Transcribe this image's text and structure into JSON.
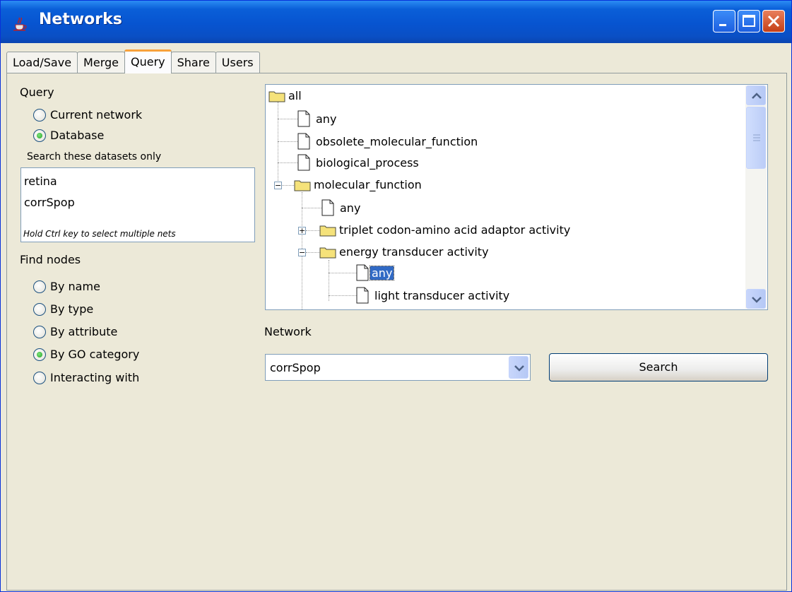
{
  "window": {
    "title": "Networks"
  },
  "tabs": [
    {
      "label": "Load/Save",
      "active": false
    },
    {
      "label": "Merge",
      "active": false
    },
    {
      "label": "Query",
      "active": true
    },
    {
      "label": "Share",
      "active": false
    },
    {
      "label": "Users",
      "active": false
    }
  ],
  "query": {
    "section_label": "Query",
    "options": [
      {
        "label": "Current network",
        "checked": false
      },
      {
        "label": "Database",
        "checked": true
      }
    ],
    "datasets_label": "Search these datasets only",
    "datasets": [
      "retina",
      "corrSpop"
    ],
    "hint": "Hold Ctrl key to select multiple nets"
  },
  "find_nodes": {
    "section_label": "Find nodes",
    "options": [
      {
        "label": "By name",
        "checked": false
      },
      {
        "label": "By type",
        "checked": false
      },
      {
        "label": "By attribute",
        "checked": false
      },
      {
        "label": "By GO category",
        "checked": true
      },
      {
        "label": "Interacting with",
        "checked": false
      }
    ]
  },
  "tree": {
    "nodes": [
      {
        "label": "all",
        "kind": "folder"
      },
      {
        "label": "any",
        "kind": "doc"
      },
      {
        "label": "obsolete_molecular_function",
        "kind": "doc"
      },
      {
        "label": "biological_process",
        "kind": "doc"
      },
      {
        "label": "molecular_function",
        "kind": "folder",
        "expanded": true
      },
      {
        "label": "any",
        "kind": "doc"
      },
      {
        "label": "triplet codon-amino acid adaptor activity",
        "kind": "folder",
        "expanded": false
      },
      {
        "label": "energy transducer activity",
        "kind": "folder",
        "expanded": true
      },
      {
        "label": "any",
        "kind": "doc",
        "selected": true
      },
      {
        "label": "light transducer activity",
        "kind": "doc"
      }
    ]
  },
  "network": {
    "label": "Network",
    "selected": "corrSpop"
  },
  "search_button": {
    "label": "Search"
  },
  "colors": {
    "titlebar": "#0754d0",
    "selection": "#316ac5",
    "tab_accent": "#f8a13b",
    "window_bg": "#ece9d8"
  }
}
